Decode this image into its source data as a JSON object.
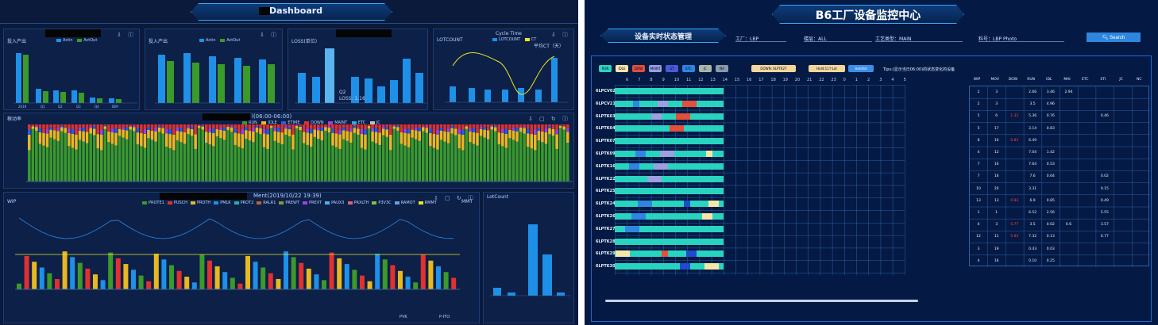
{
  "left": {
    "title": "y Dashboard",
    "card1": {
      "legend": [
        "Actin",
        "ActOut"
      ],
      "label": "投入产出"
    },
    "card2": {
      "legend": [
        "Actin",
        "ActOut"
      ],
      "label": "投入产出"
    },
    "card3": {
      "label": "LOSS(单位)",
      "sub": "Q2",
      "loss_text": "LOSS: 1.16"
    },
    "card4": {
      "title": "Cycle Time",
      "label": "LOTCOUNT",
      "legend": [
        "LOTCOUNT",
        "CT"
      ],
      "right_label": "平均CT（天）"
    },
    "state": {
      "label": "稼动率",
      "title": "l(06:00-06:00)",
      "legend": [
        "RUN",
        "IDLE",
        "ETIME",
        "DOWN",
        "MAINT",
        "ETC",
        "JC"
      ]
    },
    "wip": {
      "title": "Ment(2019/10/22 19:39)",
      "ylabel": "WIP",
      "y2label": "MMT",
      "legend": [
        "PROTE1",
        "PUSCH",
        "PROTH",
        "PMLK",
        "PROT2",
        "RALR1",
        "PREWT",
        "PREXT",
        "PAUX3",
        "PRXLTH",
        "P3V3C",
        "RAMOT",
        "RMMT"
      ],
      "lot_title": "LotCount",
      "xgroups": [
        "PVK",
        "P-ITO"
      ]
    }
  },
  "right": {
    "title": "B6工厂设备监控中心",
    "subtitle": "设备实时状态管理",
    "filters": [
      {
        "label": "工厂：LBP"
      },
      {
        "label": "楼层：ALL"
      },
      {
        "label": "工艺类型：MAIN"
      },
      {
        "label": "料号：LBP Photo"
      }
    ],
    "search": "Search",
    "chips": [
      {
        "label": "RUN",
        "color": "#2fd3c0"
      },
      {
        "label": "IDLE",
        "color": "#f5e6a8"
      },
      {
        "label": "DOW",
        "color": "#e0503a"
      },
      {
        "label": "MAINT",
        "color": "#9aa0e0"
      },
      {
        "label": "ST",
        "color": "#4a5ad8"
      },
      {
        "label": "ETC",
        "color": "#2f86e0"
      },
      {
        "label": "JC",
        "color": "#a8b8a8"
      },
      {
        "label": "NA",
        "color": "#8a9aa8"
      }
    ],
    "down_text": "DOWN: 6LPTK27",
    "hold_text": "Hold:11个Lot",
    "holdlist": "Holdlist",
    "tip": "Tips:(显示当日06:00)的状态变化的设备",
    "hours": [
      "6",
      "7",
      "8",
      "9",
      "10",
      "11",
      "12",
      "13",
      "14",
      "15",
      "16",
      "17",
      "18",
      "19",
      "20",
      "21",
      "22",
      "23",
      "0",
      "1",
      "2",
      "3",
      "4",
      "5"
    ],
    "equipment": [
      "6LPCV02",
      "6LPCV21",
      "6LPTK03",
      "6LPTK04",
      "6LPTK07",
      "6LPTK09",
      "6LPTK16",
      "6LPTK22",
      "6LPTK25",
      "6LPTK24",
      "6LPTK26",
      "6LPTK27",
      "6LPTK28",
      "6LPTK29",
      "6LPTK30"
    ],
    "table_headers": [
      "WIP",
      "MOV",
      "DOW",
      "RUN",
      "IDL",
      "MAI",
      "ETC",
      "STI",
      "JC",
      "NC"
    ],
    "table_rows": [
      [
        "2",
        "3",
        "",
        "2.66",
        "3.46",
        "2.94",
        "",
        "",
        "",
        ""
      ],
      [
        "2",
        "3",
        "",
        "3.5",
        "4.96",
        "",
        "",
        "",
        "",
        ""
      ],
      [
        "5",
        "6",
        "1.33",
        "5.36",
        "0.76",
        "",
        "",
        "0.46",
        "",
        ""
      ],
      [
        "5",
        "17",
        "",
        "3.14",
        "0.83",
        "",
        "",
        "",
        "",
        ""
      ],
      [
        "8",
        "10",
        "0.83",
        "6.49",
        "",
        "",
        "",
        "",
        "",
        ""
      ],
      [
        "4",
        "12",
        "",
        "7.04",
        "1.42",
        "",
        "",
        "",
        "",
        ""
      ],
      [
        "7",
        "16",
        "",
        "7.64",
        "0.53",
        "",
        "",
        "",
        "",
        ""
      ],
      [
        "7",
        "16",
        "",
        "7.6",
        "0.64",
        "",
        "",
        "0.02",
        "",
        ""
      ],
      [
        "10",
        "20",
        "",
        "3.31",
        "",
        "",
        "",
        "0.15",
        "",
        ""
      ],
      [
        "13",
        "13",
        "0.83",
        "6.9",
        "0.85",
        "",
        "",
        "0.49",
        "",
        ""
      ],
      [
        "1",
        "1",
        "",
        "6.52",
        "2.56",
        "",
        "",
        "5.55",
        "",
        ""
      ],
      [
        "4",
        "3",
        "0.77",
        "3.5",
        "0.02",
        "0.6",
        "",
        "3.57",
        "",
        ""
      ],
      [
        "12",
        "11",
        "0.83",
        "7.32",
        "0.13",
        "",
        "",
        "0.77",
        "",
        ""
      ],
      [
        "3",
        "19",
        "",
        "0.43",
        "0.03",
        "",
        "",
        "",
        "",
        ""
      ],
      [
        "4",
        "16",
        "",
        "0.10",
        "0.25",
        "",
        "",
        "",
        "",
        ""
      ]
    ]
  }
}
